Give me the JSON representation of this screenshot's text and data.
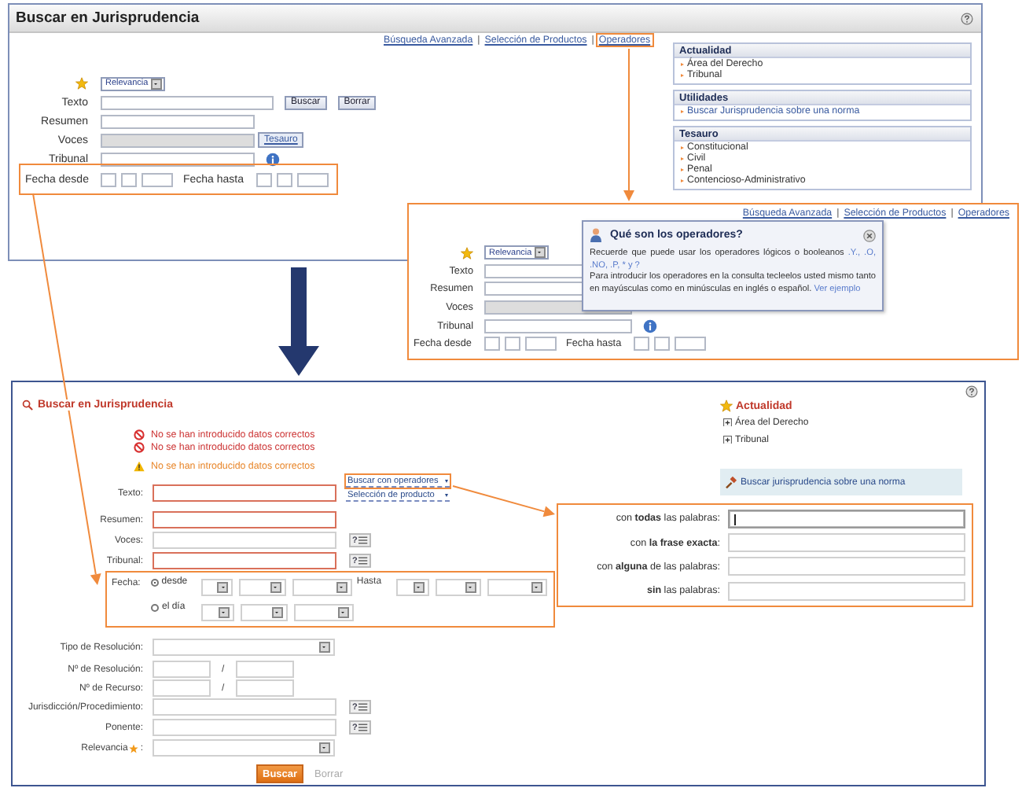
{
  "before": {
    "window": {
      "title": "Buscar en Jurisprudencia"
    },
    "links": [
      {
        "label": "Búsqueda Avanzada",
        "highlighted": false
      },
      {
        "label": "Selección de Productos",
        "highlighted": false
      },
      {
        "label": "Operadores",
        "highlighted": true
      }
    ],
    "link_separator": "|",
    "sort_select": "Relevancia",
    "fields": [
      {
        "label": "Texto",
        "kind": "buttons"
      },
      {
        "label": "Resumen",
        "kind": "text"
      },
      {
        "label": "Voces",
        "kind": "thesaurus"
      },
      {
        "label": "Tribunal",
        "kind": "info"
      }
    ],
    "buttons": [
      "Buscar",
      "Borrar"
    ],
    "thesaurus_button": "Tesauro",
    "date": {
      "from_label": "Fecha desde",
      "to_label": "Fecha hasta",
      "highlighted": true
    },
    "sidebar": [
      {
        "title": "Actualidad",
        "items": [
          "Área del Derecho",
          "Tribunal"
        ]
      },
      {
        "title": "Utilidades",
        "items": [
          "Buscar Jurisprudencia sobre una norma"
        ]
      },
      {
        "title": "Tesauro",
        "items": [
          "Constitucional",
          "Civil",
          "Penal",
          "Contencioso-Administrativo"
        ]
      }
    ]
  },
  "detail": {
    "links": [
      {
        "label": "Búsqueda Avanzada",
        "highlighted": false
      },
      {
        "label": "Selección de Productos",
        "highlighted": false
      },
      {
        "label": "Operadores",
        "highlighted": false
      }
    ],
    "link_separator": "|",
    "sort_select": "Relevancia",
    "fields": [
      {
        "label": "Texto",
        "kind": "text"
      },
      {
        "label": "Resumen",
        "kind": "text"
      },
      {
        "label": "Voces",
        "kind": "disabled"
      },
      {
        "label": "Tribunal",
        "kind": "info"
      }
    ],
    "date": {
      "from_label": "Fecha desde",
      "to_label": "Fecha hasta",
      "highlighted": false
    },
    "popup": {
      "title": "Qué son los operadores?",
      "intro": "Recuerde que puede usar los operadores lógicos o booleanos",
      "operators": ".Y., .O, .NO, .P, * y ?",
      "body": "Para introducir los operadores en la consulta tecleelos usted mismo tanto en mayúsculas como en minúsculas en inglés o español.",
      "link": "Ver ejemplo"
    }
  },
  "after": {
    "title": "Buscar en Jurisprudencia",
    "messages": [
      {
        "kind": "error",
        "text": "No se han introducido datos correctos"
      },
      {
        "kind": "error",
        "text": "No se han introducido datos correctos"
      },
      {
        "kind": "warning",
        "text": "No se han introducido datos correctos"
      }
    ],
    "search_options": [
      {
        "label": "Buscar con operadores",
        "highlighted": true
      },
      {
        "label": "Selección de producto",
        "highlighted": false
      }
    ],
    "lookup_button": "?",
    "fields": [
      {
        "label": "Texto:",
        "error": true,
        "lookup": false
      },
      {
        "label": "Resumen:",
        "error": true,
        "lookup": false
      },
      {
        "label": "Voces:",
        "error": false,
        "lookup": true
      },
      {
        "label": "Tribunal:",
        "error": true,
        "lookup": true
      }
    ],
    "date": {
      "label": "Fecha:",
      "highlighted": true,
      "modes": [
        {
          "label": "desde",
          "selected": true
        },
        {
          "label": "el día",
          "selected": false
        }
      ],
      "to_label": "Hasta"
    },
    "extra_fields": [
      {
        "label": "Tipo de Resolución:",
        "kind": "select",
        "star": false
      },
      {
        "label": "Nº de Resolución:",
        "kind": "pair",
        "separator": "/",
        "star": false
      },
      {
        "label": "Nº de Recurso:",
        "kind": "pair",
        "separator": "/",
        "star": false
      },
      {
        "label": "Jurisdicción/Procedimiento:",
        "kind": "lookup",
        "star": false
      },
      {
        "label": "Ponente:",
        "kind": "lookup",
        "star": false
      },
      {
        "label": "Relevancia",
        "kind": "select",
        "star": true,
        "suffix": ":"
      }
    ],
    "buttons": [
      {
        "label": "Buscar",
        "kind": "primary"
      },
      {
        "label": "Borrar",
        "kind": "disabled"
      }
    ],
    "sidebar": {
      "title": "Actualidad",
      "items": [
        "Área del Derecho",
        "Tribunal"
      ],
      "tool_link": "Buscar jurisprudencia sobre una norma"
    },
    "operator_fields": [
      {
        "label": "con **todas** las palabras:",
        "focused": true
      },
      {
        "label": "con **la frase exacta**:",
        "focused": false
      },
      {
        "label": "con **alguna** de las palabras:",
        "focused": false
      },
      {
        "label": "**sin** las palabras:",
        "focused": false
      }
    ]
  }
}
